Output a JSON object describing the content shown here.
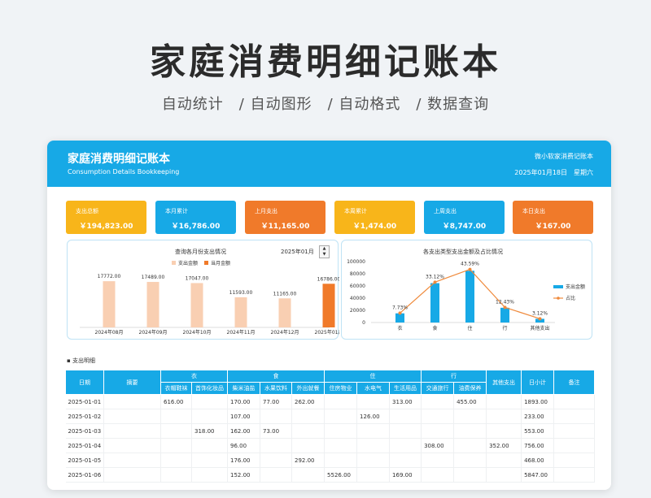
{
  "hero": {
    "title": "家庭消费明细记账本",
    "subtitle": "自动统计　/ 自动图形　/ 自动格式　/ 数据查询"
  },
  "banner": {
    "title": "家庭消费明细记账本",
    "subtitle": "Consumption Details Bookkeeping",
    "brand": "微小软家消费记账本",
    "date": "2025年01月18日　星期六"
  },
  "kpis": [
    {
      "label": "支出总额",
      "value": "￥194,823.00",
      "color": "#f8b51a"
    },
    {
      "label": "本月累计",
      "value": "￥16,786.00",
      "color": "#17a9e6"
    },
    {
      "label": "上月支出",
      "value": "￥11,165.00",
      "color": "#f07a2a"
    },
    {
      "label": "本周累计",
      "value": "￥1,474.00",
      "color": "#f8b51a"
    },
    {
      "label": "上周支出",
      "value": "￥8,747.00",
      "color": "#17a9e6"
    },
    {
      "label": "本日支出",
      "value": "￥167.00",
      "color": "#f07a2a"
    }
  ],
  "monthly_panel": {
    "title": "查询各月份支出情况",
    "selected_month": "2025年01月",
    "spin_up": "▲",
    "spin_down": "▼"
  },
  "category_panel": {
    "title": "各支出类型支出金额及占比情况"
  },
  "chart_data": [
    {
      "type": "bar",
      "categories": [
        "2024年08月",
        "2024年09月",
        "2024年10月",
        "2024年11月",
        "2024年12月",
        "2025年01月"
      ],
      "series": [
        {
          "name": "支出金额",
          "values": [
            17772,
            17489,
            17047,
            11593,
            11165,
            16786
          ],
          "color": "#f9cfb2"
        }
      ],
      "highlight_index": 5,
      "highlight_name": "当月金额",
      "highlight_color": "#f07a2a",
      "data_labels": [
        "17772.00",
        "17489.00",
        "17047.00",
        "11593.00",
        "11165.00",
        "16786.00"
      ],
      "legend_position": "top",
      "ylim": [
        0,
        20000
      ],
      "grid": false
    },
    {
      "type": "bar",
      "categories": [
        "衣",
        "食",
        "住",
        "行",
        "其他支出"
      ],
      "series": [
        {
          "name": "支出金额",
          "values": [
            15070,
            64620,
            84927,
            24212,
            6078
          ],
          "color": "#17a9e6"
        },
        {
          "name": "占比",
          "values": [
            7.73,
            33.12,
            43.59,
            12.43,
            3.12
          ],
          "color": "#ef8a3c",
          "type": "line",
          "unit": "%"
        }
      ],
      "percent_labels": [
        "7.73%",
        "33.12%",
        "43.59%",
        "12.43%",
        "3.12%"
      ],
      "y_ticks": [
        "100000",
        "80000",
        "60000",
        "40000",
        "20000",
        "0"
      ],
      "ylim": [
        0,
        100000
      ],
      "legend_position": "right",
      "grid": false
    }
  ],
  "section_title": "▪ 支出明细",
  "table": {
    "col_date": "日期",
    "col_summary": "摘要",
    "groups": [
      "衣",
      "食",
      "住",
      "行"
    ],
    "col_other": "其他支出",
    "col_subtotal": "日小计",
    "col_note": "备注",
    "subs": [
      "衣帽鞋袜",
      "首饰化妆品",
      "柴米油盐",
      "水果饮料",
      "外出就餐",
      "住房物业",
      "水电气",
      "生活用品",
      "交通旅行",
      "油费保养"
    ],
    "rows": [
      [
        "2025-01-01",
        "",
        "616.00",
        "",
        "170.00",
        "77.00",
        "262.00",
        "",
        "",
        "313.00",
        "",
        "455.00",
        "",
        "1893.00",
        ""
      ],
      [
        "2025-01-02",
        "",
        "",
        "",
        "107.00",
        "",
        "",
        "",
        "126.00",
        "",
        "",
        "",
        "",
        "233.00",
        ""
      ],
      [
        "2025-01-03",
        "",
        "",
        "318.00",
        "162.00",
        "73.00",
        "",
        "",
        "",
        "",
        "",
        "",
        "",
        "553.00",
        ""
      ],
      [
        "2025-01-04",
        "",
        "",
        "",
        "96.00",
        "",
        "",
        "",
        "",
        "",
        "308.00",
        "",
        "352.00",
        "756.00",
        ""
      ],
      [
        "2025-01-05",
        "",
        "",
        "",
        "176.00",
        "",
        "292.00",
        "",
        "",
        "",
        "",
        "",
        "",
        "468.00",
        ""
      ],
      [
        "2025-01-06",
        "",
        "",
        "",
        "152.00",
        "",
        "",
        "5526.00",
        "",
        "169.00",
        "",
        "",
        "",
        "5847.00",
        ""
      ]
    ]
  }
}
